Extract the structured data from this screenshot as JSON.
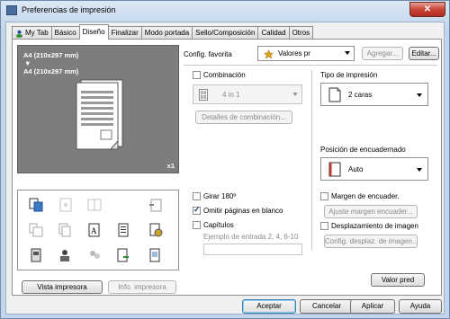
{
  "window": {
    "title": "Preferencias de impresión",
    "close_label": "✕"
  },
  "tabs": [
    {
      "label": "My Tab"
    },
    {
      "label": "Básico"
    },
    {
      "label": "Diseño"
    },
    {
      "label": "Finalizar"
    },
    {
      "label": "Modo portada"
    },
    {
      "label": "Sello/Composición"
    },
    {
      "label": "Calidad"
    },
    {
      "label": "Otros"
    }
  ],
  "active_tab": "Diseño",
  "preview": {
    "line1": "A4 (210x297 mm)",
    "arrow": "▼",
    "line2": "A4 (210x297 mm)",
    "count": "x1"
  },
  "left_buttons": {
    "printer_view": "Vista impresora",
    "printer_info": "Info. impresora"
  },
  "favorites": {
    "label": "Config. favorita",
    "value": "Valores pr",
    "add": "Agregar...",
    "edit": "Editar..."
  },
  "combination": {
    "label": "Combinación",
    "checked": false,
    "select_value": "4 in 1",
    "details": "Detalles de combinación..."
  },
  "print_type": {
    "label": "Tipo de impresión",
    "value": "2 caras"
  },
  "binding_position": {
    "label": "Posición de encuadernado",
    "value": "Auto"
  },
  "rotate": {
    "label": "Girar 180º",
    "checked": false
  },
  "skip_blank": {
    "label": "Omitir páginas en blanco",
    "checked": true
  },
  "chapters": {
    "label": "Capítulos",
    "checked": false,
    "placeholder": "Ejemplo de entrada 2, 4, 6-10"
  },
  "binding_margin": {
    "label": "Margen de encuader.",
    "checked": false,
    "button": "Ajuste margen encuader..."
  },
  "image_shift": {
    "label": "Desplazamiento de imagen",
    "checked": false,
    "button": "Config. desplaz. de imagen..."
  },
  "default_button": "Valor pred",
  "footer": {
    "ok": "Aceptar",
    "cancel": "Cancelar",
    "apply": "Aplicar",
    "help": "Ayuda"
  },
  "colors": {
    "accent": "#3c7fb1",
    "preview_bg": "#7d7d7d",
    "title_bg": "#c3d6ec"
  }
}
